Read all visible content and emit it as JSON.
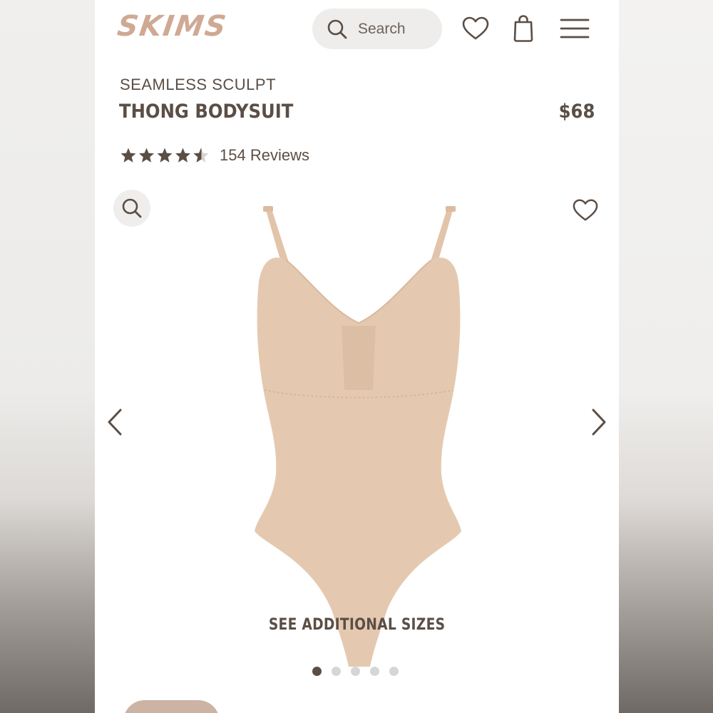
{
  "header": {
    "logo_text": "SKIMS",
    "search_placeholder": "Search",
    "icons": [
      "search-icon",
      "heart-icon",
      "bag-icon",
      "menu-icon"
    ]
  },
  "product": {
    "collection": "SEAMLESS SCULPT",
    "name": "THONG BODYSUIT",
    "price": "$68",
    "rating": 4.5,
    "rating_max": 5,
    "reviews_label": "154 Reviews"
  },
  "gallery": {
    "see_sizes_label": "SEE ADDITIONAL SIZES",
    "slide_count": 5,
    "active_slide": 1,
    "icons": [
      "zoom-icon",
      "wishlist-heart-icon",
      "chevron-left-icon",
      "chevron-right-icon"
    ]
  },
  "colors": {
    "text": "#5b4e45",
    "logo": "#cfa994",
    "product_fill": "#e4c9b0",
    "active_dot": "#5b4e45",
    "inactive_dot": "#d6d6d6"
  }
}
